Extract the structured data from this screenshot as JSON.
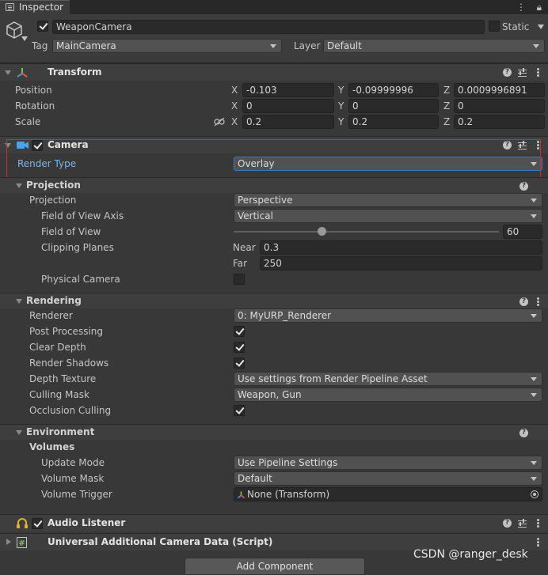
{
  "tab": {
    "label": "Inspector"
  },
  "header": {
    "object_name": "WeaponCamera",
    "static_label": "Static",
    "tag_label": "Tag",
    "tag_value": "MainCamera",
    "layer_label": "Layer",
    "layer_value": "Default"
  },
  "transform": {
    "title": "Transform",
    "position": {
      "label": "Position",
      "x": "-0.103",
      "y": "-0.09999996",
      "z": "0.0009996891"
    },
    "rotation": {
      "label": "Rotation",
      "x": "0",
      "y": "0",
      "z": "0"
    },
    "scale": {
      "label": "Scale",
      "x": "0.2",
      "y": "0.2",
      "z": "0.2"
    },
    "axis": {
      "x": "X",
      "y": "Y",
      "z": "Z"
    }
  },
  "camera": {
    "title": "Camera",
    "render_type_label": "Render Type",
    "render_type_value": "Overlay"
  },
  "projection": {
    "section_title": "Projection",
    "projection_label": "Projection",
    "projection_value": "Perspective",
    "fov_axis_label": "Field of View Axis",
    "fov_axis_value": "Vertical",
    "fov_label": "Field of View",
    "fov_value": "60",
    "fov_slider_fraction": 0.33,
    "clipping_label": "Clipping Planes",
    "near_label": "Near",
    "near_value": "0.3",
    "far_label": "Far",
    "far_value": "250",
    "physical_label": "Physical Camera"
  },
  "rendering": {
    "section_title": "Rendering",
    "renderer_label": "Renderer",
    "renderer_value": "0: MyURP_Renderer",
    "post_processing_label": "Post Processing",
    "clear_depth_label": "Clear Depth",
    "render_shadows_label": "Render Shadows",
    "depth_texture_label": "Depth Texture",
    "depth_texture_value": "Use settings from Render Pipeline Asset",
    "culling_mask_label": "Culling Mask",
    "culling_mask_value": "Weapon, Gun",
    "occlusion_label": "Occlusion Culling"
  },
  "environment": {
    "section_title": "Environment",
    "volumes_label": "Volumes",
    "update_mode_label": "Update Mode",
    "update_mode_value": "Use Pipeline Settings",
    "volume_mask_label": "Volume Mask",
    "volume_mask_value": "Default",
    "volume_trigger_label": "Volume Trigger",
    "volume_trigger_value": "None (Transform)"
  },
  "audio_listener": {
    "title": "Audio Listener"
  },
  "additional_data": {
    "title": "Universal Additional Camera Data (Script)"
  },
  "add_component": {
    "label": "Add Component"
  },
  "watermark": "CSDN @ranger_desk"
}
